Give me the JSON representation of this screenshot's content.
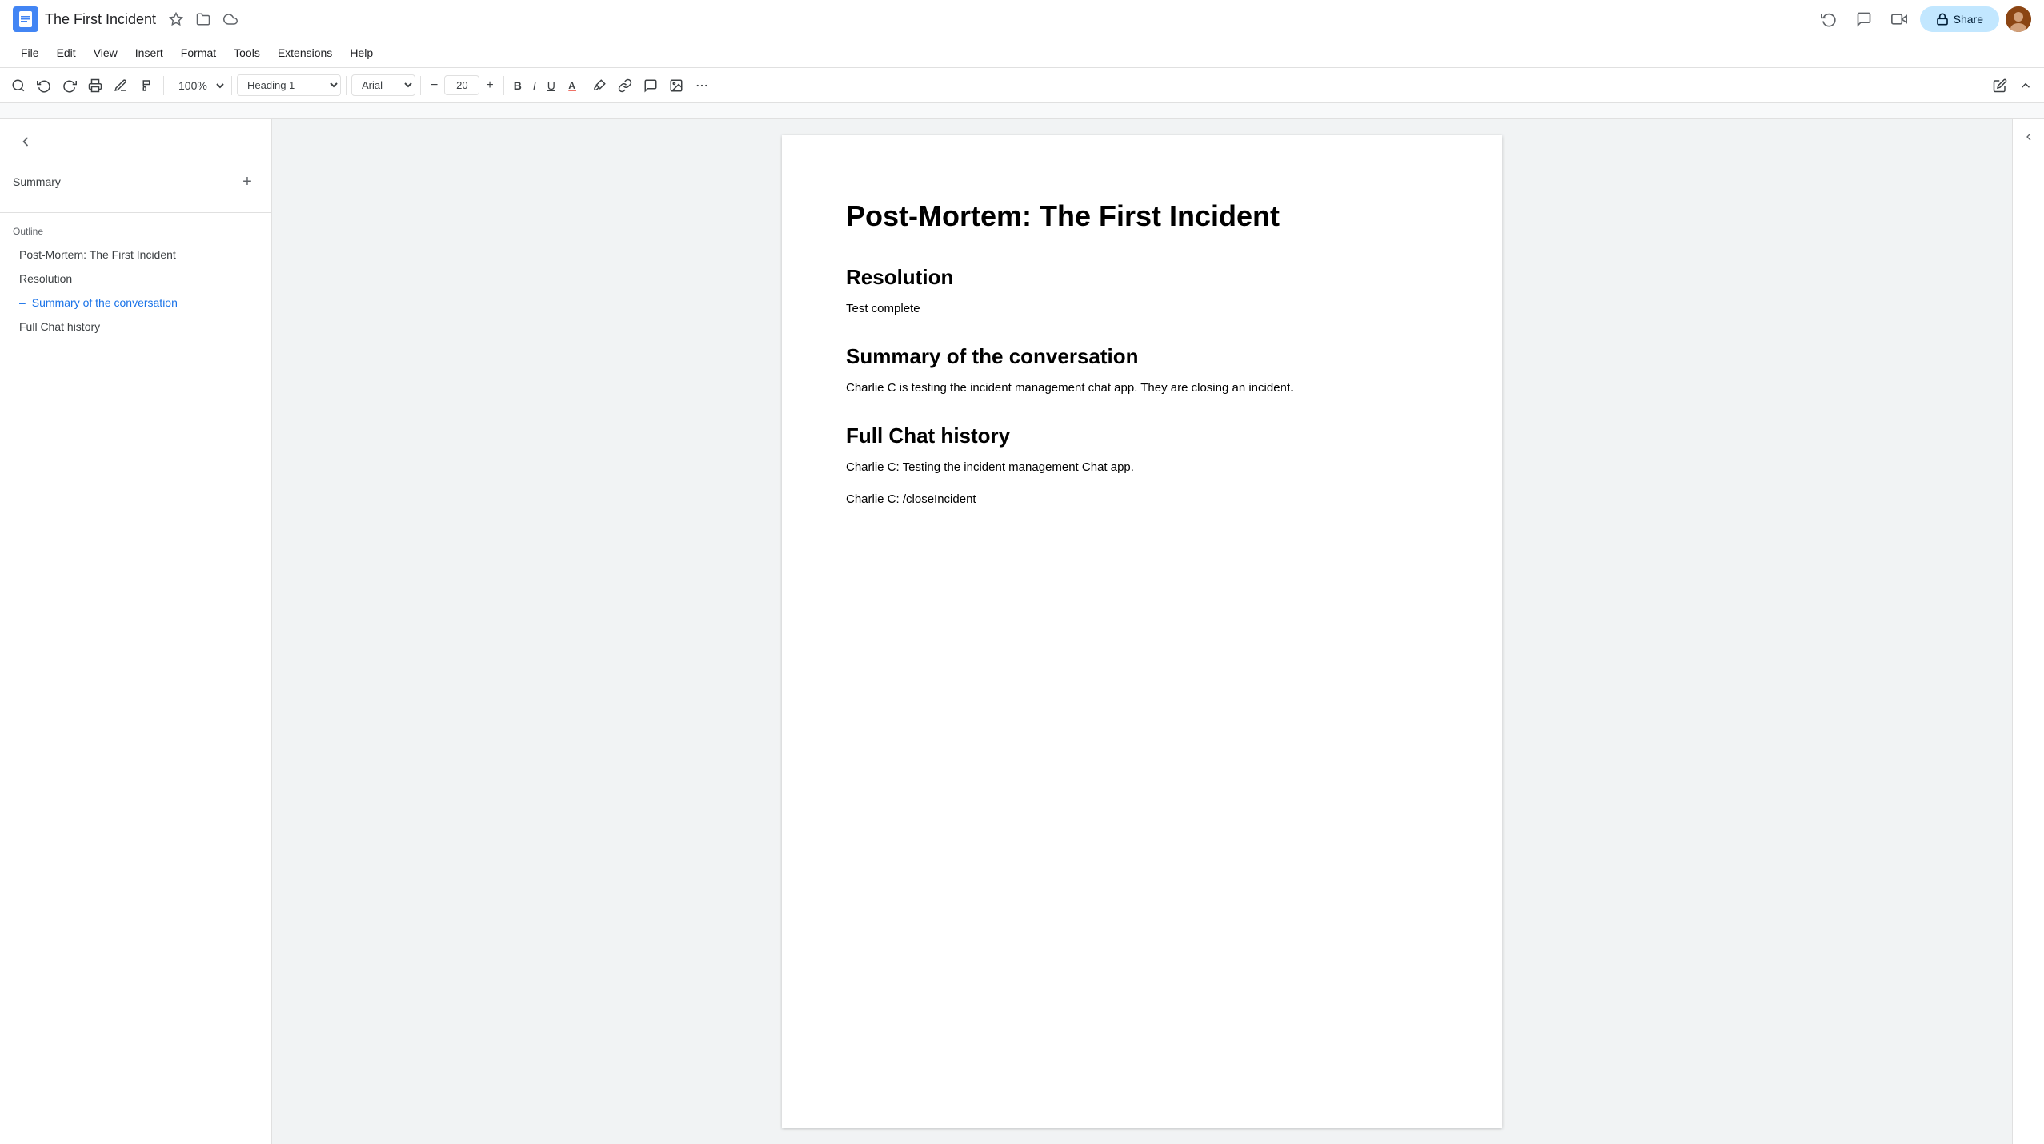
{
  "app": {
    "name": "Google Docs"
  },
  "titlebar": {
    "doc_title": "The First Incident",
    "favorite_icon": "☆",
    "folder_icon": "📁",
    "cloud_icon": "☁"
  },
  "menubar": {
    "items": [
      "File",
      "Edit",
      "View",
      "Insert",
      "Format",
      "Tools",
      "Extensions",
      "Help"
    ]
  },
  "toolbar": {
    "zoom": "100%",
    "heading_style": "Heading 1",
    "font": "Arial",
    "font_size": "20",
    "bold": "B",
    "italic": "I",
    "underline": "U"
  },
  "topright": {
    "share_label": "Share"
  },
  "sidebar": {
    "summary_label": "Summary",
    "outline_label": "Outline",
    "outline_items": [
      {
        "id": "1",
        "text": "Post-Mortem: The First Incident",
        "active": false
      },
      {
        "id": "2",
        "text": "Resolution",
        "active": false
      },
      {
        "id": "3",
        "text": "Summary of the conversation",
        "active": true
      },
      {
        "id": "4",
        "text": "Full Chat history",
        "active": false
      }
    ]
  },
  "document": {
    "title": "Post-Mortem: The First Incident",
    "sections": [
      {
        "id": "resolution",
        "heading": "Resolution",
        "body": "Test complete"
      },
      {
        "id": "summary",
        "heading": "Summary of the conversation",
        "body": "Charlie C is testing the incident management chat app. They are closing an incident."
      },
      {
        "id": "chat",
        "heading": "Full Chat history",
        "lines": [
          "Charlie C: Testing the incident management Chat app.",
          "Charlie C: /closeIncident"
        ]
      }
    ]
  }
}
